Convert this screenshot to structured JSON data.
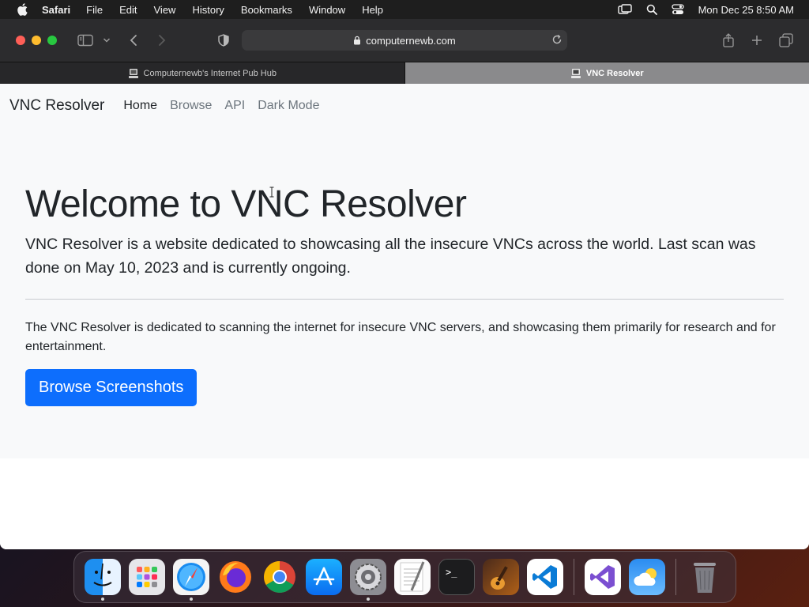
{
  "menubar": {
    "app_name": "Safari",
    "items": [
      "File",
      "Edit",
      "View",
      "History",
      "Bookmarks",
      "Window",
      "Help"
    ],
    "clock": "Mon Dec 25  8:50 AM",
    "status_icons": [
      "screen-mirroring-icon",
      "search-icon",
      "control-center-icon"
    ]
  },
  "browser": {
    "url": "computernewb.com",
    "tabs": [
      {
        "label": "Computernewb's Internet Pub Hub",
        "active": false
      },
      {
        "label": "VNC Resolver",
        "active": true
      }
    ]
  },
  "site": {
    "brand": "VNC Resolver",
    "nav": [
      {
        "label": "Home",
        "active": true
      },
      {
        "label": "Browse",
        "active": false
      },
      {
        "label": "API",
        "active": false
      },
      {
        "label": "Dark Mode",
        "active": false
      }
    ],
    "heading": "Welcome to VNC Resolver",
    "lead": "VNC Resolver is a website dedicated to showcasing all the insecure VNCs across the world. Last scan was done on May 10, 2023 and is currently ongoing.",
    "body": "The VNC Resolver is dedicated to scanning the internet for insecure VNC servers, and showcasing them primarily for research and for entertainment.",
    "button": "Browse Screenshots"
  },
  "dock": {
    "apps": [
      "finder-icon",
      "launchpad-icon",
      "safari-icon",
      "firefox-icon",
      "chrome-icon",
      "app-store-icon",
      "system-settings-icon",
      "textedit-icon",
      "terminal-icon",
      "garageband-icon",
      "vscode-icon",
      "visual-studio-icon",
      "weather-icon",
      "trash-icon"
    ]
  },
  "colors": {
    "primary": "#0d6efd",
    "navbar_bg": "#f8f9fa",
    "text": "#212529",
    "muted": "#6c757d"
  }
}
